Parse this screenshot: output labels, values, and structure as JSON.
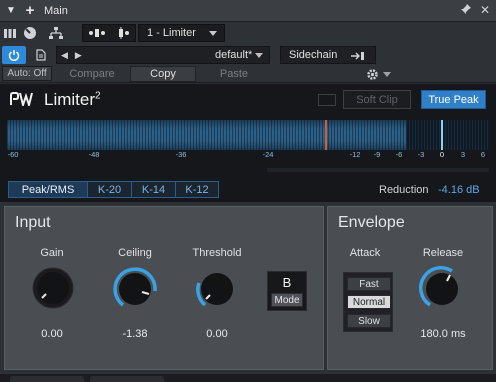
{
  "window": {
    "title": "Main"
  },
  "toolbar": {
    "device_name": "1 - Limiter",
    "preset_name": "default*",
    "sidechain_label": "Sidechain",
    "auto_label": "Auto: Off",
    "compare_label": "Compare",
    "copy_label": "Copy",
    "paste_label": "Paste"
  },
  "plugin": {
    "name": "Limiter",
    "version_mark": "2",
    "soft_clip_label": "Soft Clip",
    "true_peak_label": "True Peak",
    "soft_clip_enabled": false,
    "true_peak_enabled": true
  },
  "meter": {
    "scale_labels": [
      "-60",
      "-48",
      "-36",
      "-24",
      "-12",
      "-9",
      "-6",
      "-3",
      "0",
      "3",
      "6"
    ],
    "tabs": [
      "Peak/RMS",
      "K-20",
      "K-14",
      "K-12"
    ],
    "active_tab": "Peak/RMS",
    "reduction_label": "Reduction",
    "reduction_value": "-4.16 dB"
  },
  "input": {
    "title": "Input",
    "gain": {
      "label": "Gain",
      "value": "0.00"
    },
    "ceiling": {
      "label": "Ceiling",
      "value": "-1.38"
    },
    "threshold": {
      "label": "Threshold",
      "value": "0.00"
    },
    "mode": {
      "value": "B",
      "label": "Mode"
    }
  },
  "envelope": {
    "title": "Envelope",
    "attack": {
      "label": "Attack",
      "options": [
        "Fast",
        "Normal",
        "Slow"
      ],
      "selected": "Normal"
    },
    "release": {
      "label": "Release",
      "value": "180.0 ms"
    }
  },
  "colors": {
    "accent": "#2f7fc9",
    "meter_peak": "#d65a2e",
    "reduction": "#5aa9ea"
  }
}
